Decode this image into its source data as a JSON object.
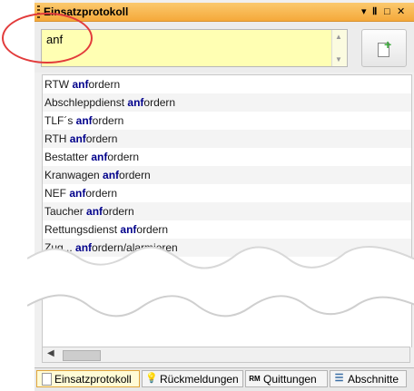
{
  "window": {
    "title": "Einsatzprotokoll",
    "controls": [
      "▾",
      "Ⅱ",
      "□",
      "✕"
    ]
  },
  "search": {
    "value": "anf"
  },
  "list": {
    "highlight": "anf",
    "items": [
      {
        "pre": "RTW ",
        "hl": "anf",
        "post": "ordern"
      },
      {
        "pre": "Abschleppdienst ",
        "hl": "anf",
        "post": "ordern"
      },
      {
        "pre": "TLF´s ",
        "hl": "anf",
        "post": "ordern"
      },
      {
        "pre": "RTH ",
        "hl": "anf",
        "post": "ordern"
      },
      {
        "pre": "Bestatter ",
        "hl": "anf",
        "post": "ordern"
      },
      {
        "pre": "Kranwagen ",
        "hl": "anf",
        "post": "ordern"
      },
      {
        "pre": "NEF ",
        "hl": "anf",
        "post": "ordern"
      },
      {
        "pre": "Taucher ",
        "hl": "anf",
        "post": "ordern"
      },
      {
        "pre": "Rettungsdienst ",
        "hl": "anf",
        "post": "ordern"
      },
      {
        "pre": "Zug... ",
        "hl": "anf",
        "post": "ordern/alarmieren"
      }
    ]
  },
  "tabs": [
    {
      "label": "Einsatzprotokoll",
      "icon": "page-icon",
      "active": true
    },
    {
      "label": "Rückmeldungen",
      "icon": "lightbulb-icon",
      "active": false
    },
    {
      "label": "Quittungen",
      "icon": "rm-icon",
      "active": false
    },
    {
      "label": "Abschnitte",
      "icon": "list-icon",
      "active": false
    }
  ],
  "colors": {
    "titlebar": "#f5a93a",
    "search_bg": "#ffffb3",
    "highlight": "#00008b",
    "annotation": "#e23b3b"
  }
}
